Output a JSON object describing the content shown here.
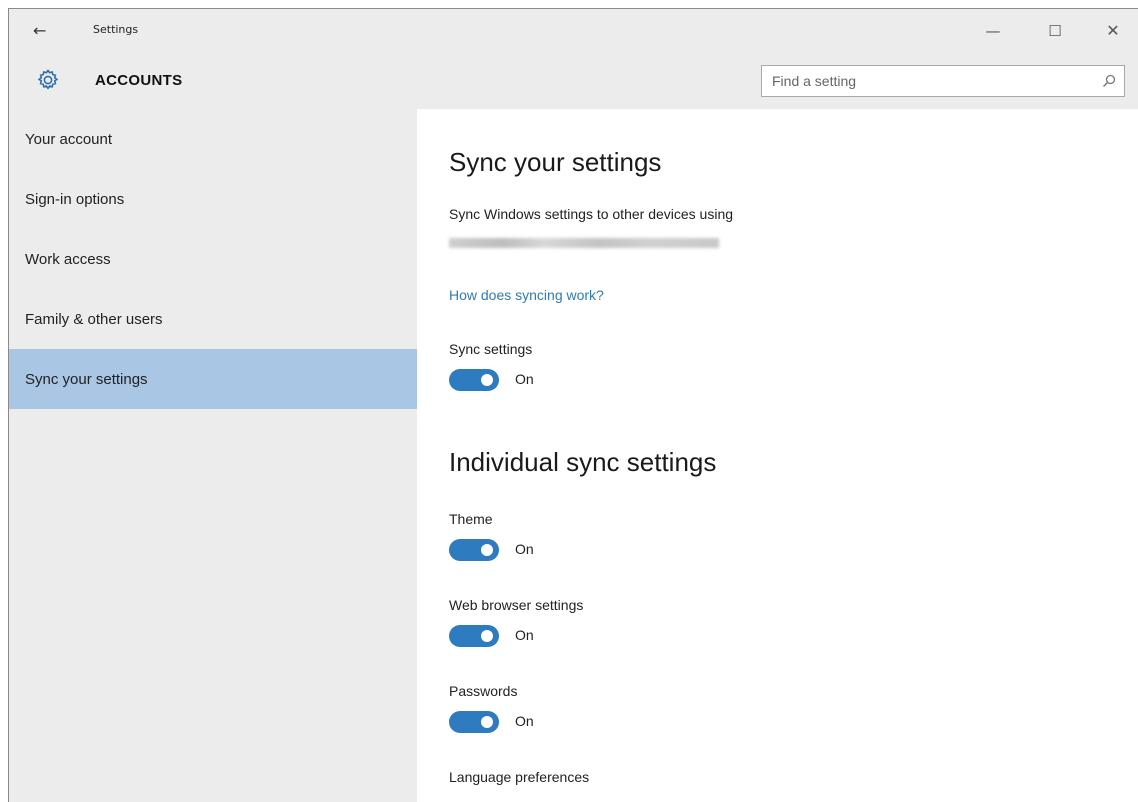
{
  "titlebar": {
    "title": "Settings",
    "back_glyph": "←",
    "minimize_glyph": "—",
    "maximize_glyph": "☐",
    "close_glyph": "✕",
    "icons": [
      "back-arrow-icon",
      "minimize-icon",
      "maximize-icon",
      "close-icon"
    ]
  },
  "header": {
    "section_title": "ACCOUNTS",
    "icon": "gear-icon",
    "search": {
      "placeholder": "Find a setting",
      "value": "",
      "icon": "search-icon"
    }
  },
  "sidebar": {
    "items": [
      {
        "label": "Your account",
        "active": false
      },
      {
        "label": "Sign-in options",
        "active": false
      },
      {
        "label": "Work access",
        "active": false
      },
      {
        "label": "Family & other users",
        "active": false
      },
      {
        "label": "Sync your settings",
        "active": true
      }
    ]
  },
  "main": {
    "title": "Sync your settings",
    "description": "Sync Windows settings to other devices using",
    "link": "How does syncing work?",
    "sync_settings": {
      "label": "Sync settings",
      "state": "On",
      "on": true
    },
    "individual_title": "Individual sync settings",
    "individual": [
      {
        "label": "Theme",
        "state": "On",
        "on": true
      },
      {
        "label": "Web browser settings",
        "state": "On",
        "on": true
      },
      {
        "label": "Passwords",
        "state": "On",
        "on": true
      }
    ],
    "next_label": "Language preferences"
  },
  "colors": {
    "chrome_bg": "#ececec",
    "active_nav_bg": "#a9c6e5",
    "toggle_on": "#2f7bbf",
    "link": "#2e7bb8"
  }
}
